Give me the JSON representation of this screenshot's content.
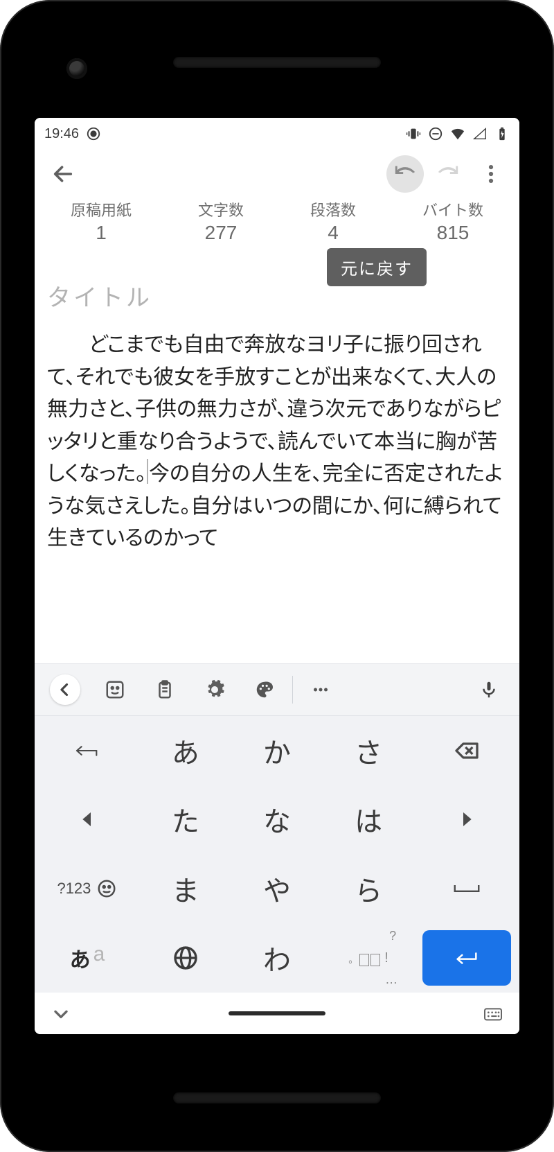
{
  "status": {
    "time": "19:46"
  },
  "toolbar": {
    "undo_tooltip": "元に戻す"
  },
  "stats": {
    "pages": {
      "label": "原稿用紙",
      "value": "1"
    },
    "chars": {
      "label": "文字数",
      "value": "277"
    },
    "paragraphs": {
      "label": "段落数",
      "value": "4"
    },
    "bytes": {
      "label": "バイト数",
      "value": "815"
    }
  },
  "editor": {
    "title_placeholder": "タイトル",
    "body_before_caret": "どこまでも自由で奔放なヨリ子に振り回されて、それでも彼女を手放すことが出来なくて、大人の無力さと、子供の無力さが、違う次元でありながらピッタリと重なり合うようで、読んでいて本当に胸が苦しくなった。",
    "body_after_caret": "今の自分の人生を、完全に否定されたような気さえした。自分はいつの間にか、何に縛られて生きているのかって"
  },
  "keyboard": {
    "numeric_label": "?123",
    "lang_a": "あ",
    "lang_b": "a",
    "rows": [
      [
        "あ",
        "か",
        "さ"
      ],
      [
        "た",
        "な",
        "は"
      ],
      [
        "ま",
        "や",
        "ら"
      ],
      [
        "",
        "わ",
        ""
      ]
    ],
    "punct_hint_top": "?",
    "punct_hint_side": "!",
    "punct_hint_bottom": "…"
  }
}
